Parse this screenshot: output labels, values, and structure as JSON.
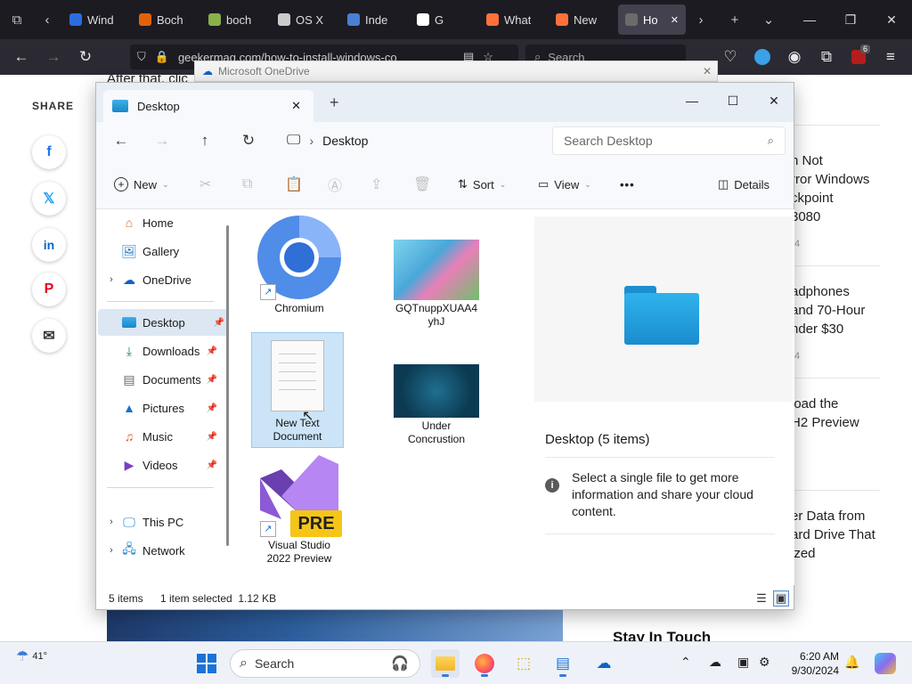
{
  "browser": {
    "tabs": [
      {
        "label": "Wind",
        "color": "#2d6cdf"
      },
      {
        "label": "Boch",
        "color": "#e36209"
      },
      {
        "label": "boch",
        "color": "#88b04b"
      },
      {
        "label": "OS X",
        "color": "#cccccc"
      },
      {
        "label": "Inde",
        "color": "#4a7fd4"
      },
      {
        "label": "G",
        "color": "#ffffff"
      },
      {
        "label": "What",
        "color": "#ff7139"
      },
      {
        "label": "New",
        "color": "#ff7139"
      },
      {
        "label": "Ho",
        "color": "#6b6b6b"
      }
    ],
    "url": "geekermag.com/how-to-install-windows-co",
    "search_placeholder": "Search",
    "extension_badge": "6"
  },
  "webpage": {
    "article_fragment": "After that, clic",
    "share_label": "SHARE",
    "share_buttons": [
      "f",
      "𝕏",
      "in",
      "P",
      "✉"
    ],
    "sidebar": [
      {
        "lines": "n Not\nrror Windows\nckpoint\n3080",
        "date": "4"
      },
      {
        "lines": "adphones\nand 70-Hour\nnder $30",
        "date": "4"
      },
      {
        "lines": "load the\nH2 Preview",
        "date": ""
      },
      {
        "lines": "er Data from\nard Drive That\nized",
        "date": ""
      }
    ],
    "stay_in_touch": "Stay In Touch"
  },
  "onedrive": {
    "title": "Microsoft OneDrive"
  },
  "explorer": {
    "tab_title": "Desktop",
    "path": "Desktop",
    "search_placeholder": "Search Desktop",
    "commands": {
      "new": "New",
      "sort": "Sort",
      "view": "View",
      "details": "Details"
    },
    "nav": {
      "home": "Home",
      "gallery": "Gallery",
      "onedrive": "OneDrive",
      "desktop": "Desktop",
      "downloads": "Downloads",
      "documents": "Documents",
      "pictures": "Pictures",
      "music": "Music",
      "videos": "Videos",
      "this_pc": "This PC",
      "network": "Network"
    },
    "files": [
      {
        "name": "Chromium"
      },
      {
        "name": "GQTnuppXUAA4yhJ"
      },
      {
        "name": "New Text Document"
      },
      {
        "name": "Under Concrustion"
      },
      {
        "name": "Visual Studio 2022 Preview"
      }
    ],
    "details": {
      "title": "Desktop (5 items)",
      "info": "Select a single file to get more information and share your cloud content."
    },
    "status": {
      "items": "5 items",
      "selected": "1 item selected  1.12 KB"
    }
  },
  "taskbar": {
    "weather": "41°",
    "search_placeholder": "Search",
    "time": "6:20 AM",
    "date": "9/30/2024"
  },
  "colors": {
    "accent": "#0067c0",
    "taskbar_bg": "#eef2f8",
    "browser_tabbar": "#1c1b22"
  }
}
